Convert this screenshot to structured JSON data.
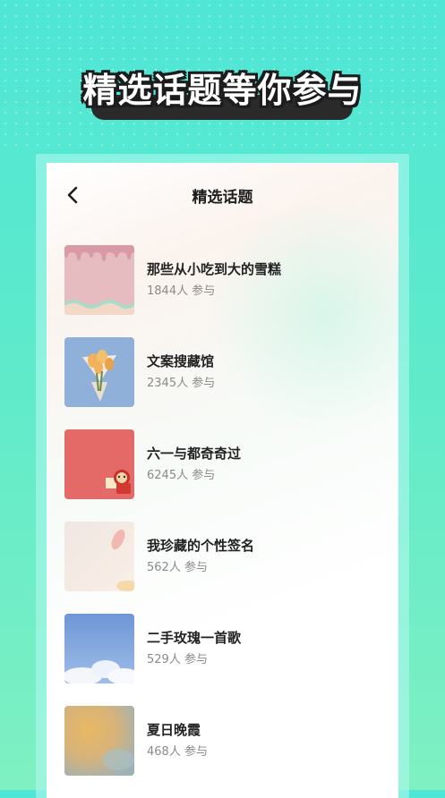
{
  "promo": {
    "headline": "精选话题等你参与"
  },
  "nav": {
    "title": "精选话题",
    "back_icon": "chevron-left-icon"
  },
  "colors": {
    "bg_top": "#4fe6d6",
    "bg_bottom": "#7ff0c2",
    "title_text": "#222222",
    "meta_text": "#8a8a8a"
  },
  "topics": [
    {
      "title": "那些从小吃到大的雪糕",
      "count": "1844人",
      "suffix": "参与",
      "thumb": "pink-drip-image"
    },
    {
      "title": "文案搜藏馆",
      "count": "2345人",
      "suffix": "参与",
      "thumb": "flower-bouquet-image"
    },
    {
      "title": "六一与都奇奇过",
      "count": "6245人",
      "suffix": "参与",
      "thumb": "red-sticker-image"
    },
    {
      "title": "我珍藏的个性签名",
      "count": "562人",
      "suffix": "参与",
      "thumb": "petal-image"
    },
    {
      "title": "二手玫瑰一首歌",
      "count": "529人",
      "suffix": "参与",
      "thumb": "sky-cloud-image"
    },
    {
      "title": "夏日晚霞",
      "count": "468人",
      "suffix": "参与",
      "thumb": "sunset-blur-image"
    }
  ]
}
